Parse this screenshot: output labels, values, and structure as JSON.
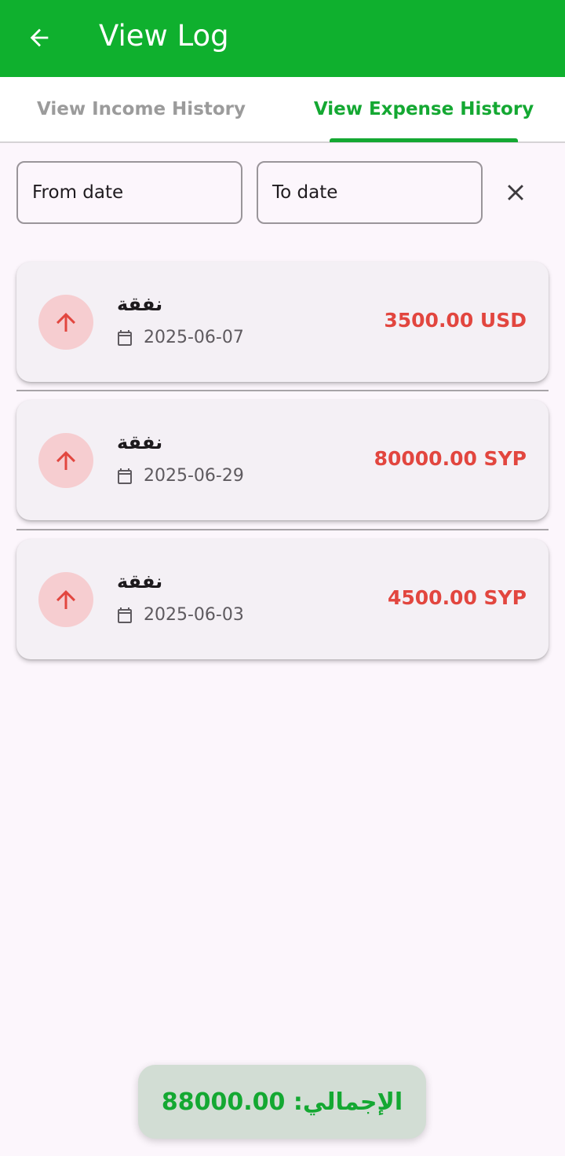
{
  "appbar": {
    "title": "View Log",
    "back_icon": "arrow-back-icon"
  },
  "tabs": [
    {
      "label": "View Income History",
      "selected": false
    },
    {
      "label": "View Expense History",
      "selected": true
    }
  ],
  "filters": {
    "from_placeholder": "From date",
    "to_placeholder": "To date",
    "clear_icon": "close-icon"
  },
  "colors": {
    "brand": "#0fb02e",
    "accent": "#14a832",
    "expense": "#e2463f",
    "expense_icon_bg": "#f6cdd0",
    "card_bg": "#f4f0f5",
    "page_bg": "#fcf6fc"
  },
  "transactions": [
    {
      "title": "نفقة",
      "date": "2025-06-07",
      "amount": "3500.00 USD",
      "icon": "arrow-up-icon"
    },
    {
      "title": "نفقة",
      "date": "2025-06-29",
      "amount": "80000.00 SYP",
      "icon": "arrow-up-icon"
    },
    {
      "title": "نفقة",
      "date": "2025-06-03",
      "amount": "4500.00 SYP",
      "icon": "arrow-up-icon"
    }
  ],
  "total": {
    "text": "الإجمالي: 88000.00"
  }
}
